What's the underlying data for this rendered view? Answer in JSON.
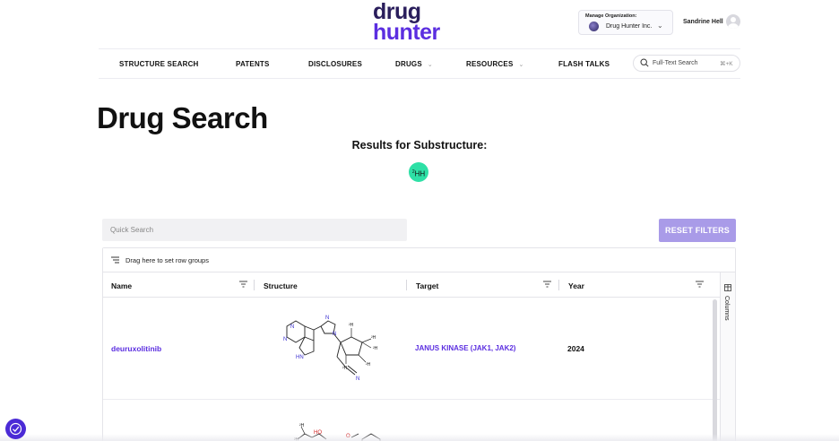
{
  "header": {
    "logo_line1": "drug",
    "logo_line2": "hunter",
    "org_label": "Manage Organization:",
    "org_name": "Drug Hunter Inc.",
    "user_name": "Sandrine Hell"
  },
  "nav": {
    "items": [
      {
        "label": "STRUCTURE SEARCH",
        "dropdown": false
      },
      {
        "label": "PATENTS",
        "dropdown": false
      },
      {
        "label": "DISCLOSURES",
        "dropdown": false
      },
      {
        "label": "DRUGS",
        "dropdown": true
      },
      {
        "label": "RESOURCES",
        "dropdown": true
      },
      {
        "label": "FLASH TALKS",
        "dropdown": false
      }
    ],
    "search_placeholder": "Full-Text Search",
    "search_shortcut": "⌘+K"
  },
  "page": {
    "title": "Drug Search",
    "results_label": "Results for Substructure:",
    "substructure": "HH",
    "substructure_prefix": "2"
  },
  "grid": {
    "quick_search_placeholder": "Quick Search",
    "reset_label": "RESET FILTERS",
    "group_hint": "Drag here to set row groups",
    "columns": [
      "Name",
      "Structure",
      "Target",
      "Year"
    ],
    "side_panel_label": "Columns",
    "rows": [
      {
        "name": "deuruxolitinib",
        "target": "JANUS KINASE (JAK1, JAK2)",
        "year": "2024"
      }
    ]
  },
  "colors": {
    "brand_dark": "#2a1e5c",
    "brand_purple": "#5b2ee0",
    "reset_button": "#a99be8",
    "substructure_chip": "#2ee0a6"
  }
}
